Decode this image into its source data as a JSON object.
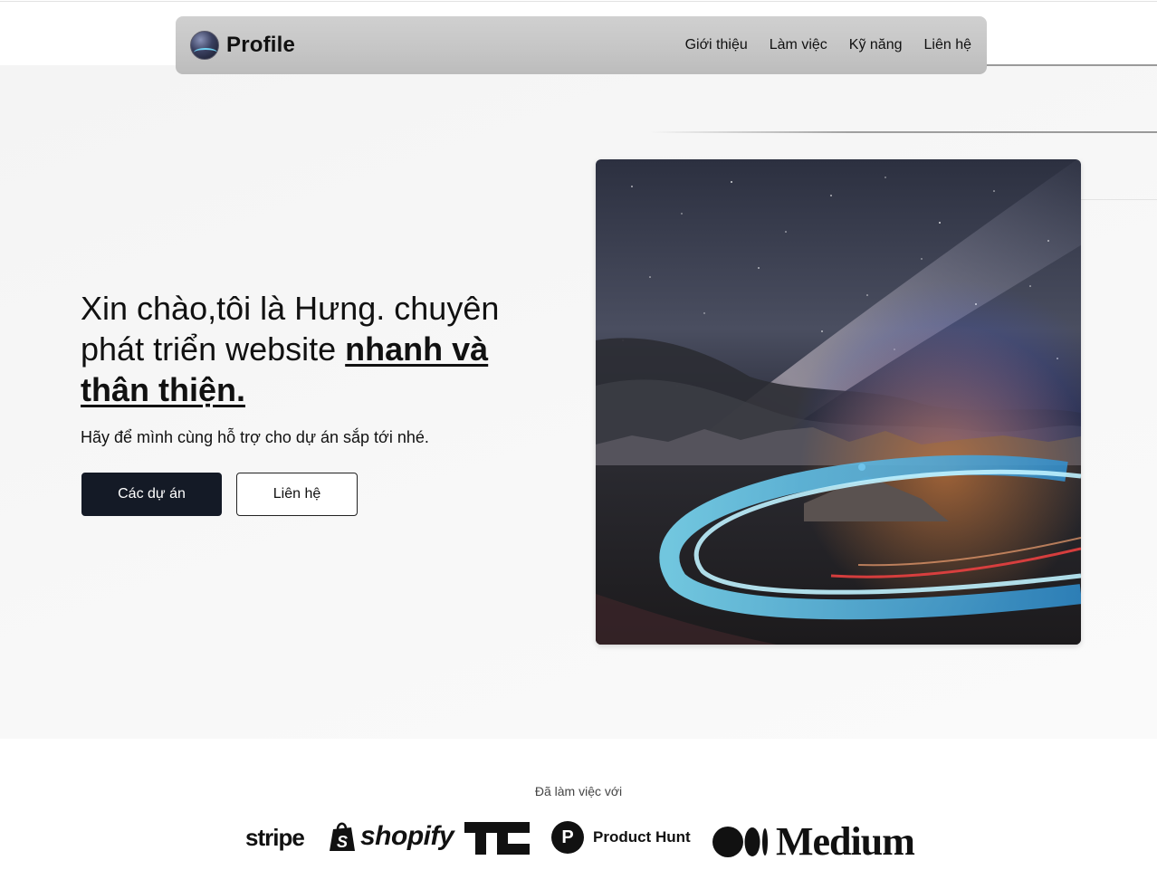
{
  "nav": {
    "brand": "Profile",
    "links": [
      "Giới thiệu",
      "Làm việc",
      "Kỹ năng",
      "Liên hệ"
    ]
  },
  "hero": {
    "title_plain": "Xin chào,tôi là Hưng. chuyên phát triển website ",
    "title_highlight": "nhanh và thân thiện.",
    "subtitle": "Hãy để mình cùng hỗ trợ cho dự án sắp tới nhé.",
    "primary_button": "Các dự án",
    "secondary_button": "Liên hệ"
  },
  "partners": {
    "label": "Đã làm việc với",
    "logos": {
      "stripe": "stripe",
      "shopify": "shopify",
      "product_hunt": "Product Hunt",
      "product_hunt_mark": "P",
      "medium": "Medium"
    }
  },
  "colors": {
    "primary_button_bg": "#141a26",
    "navbar_bg": "#c6c6c6",
    "hero_bg": "#f6f6f6"
  },
  "icons": [
    "avatar-night-road",
    "shopify-bag-icon",
    "techcrunch-icon",
    "product-hunt-icon",
    "medium-icon"
  ]
}
